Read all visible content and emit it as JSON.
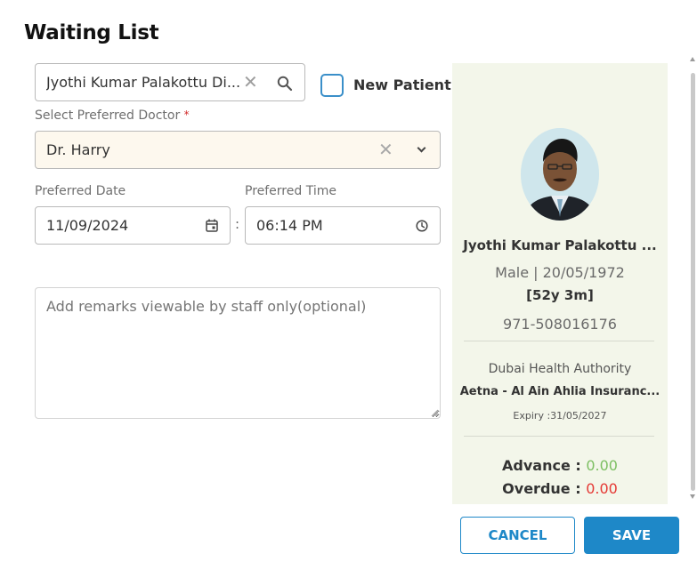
{
  "dialog": {
    "title": "Waiting List"
  },
  "form": {
    "patient_search_value": "Jyothi Kumar Palakottu   Di...",
    "new_patient_label": "New Patient",
    "doctor_label": "Select Preferred Doctor",
    "doctor_required_mark": "*",
    "doctor_value": "Dr. Harry",
    "date_label": "Preferred Date",
    "date_value": "11/09/2024",
    "time_separator": ":",
    "time_label": "Preferred Time",
    "time_value": "06:14 PM",
    "remarks_placeholder": "Add remarks viewable by staff only(optional)"
  },
  "patient_card": {
    "name": "Jyothi Kumar Palakottu ...",
    "gender_dob": "Male | 20/05/1972",
    "age": "[52y 3m]",
    "phone": "971-508016176",
    "authority": "Dubai Health Authority",
    "insurance": "Aetna - Al Ain Ahlia Insuranc...",
    "expiry": "Expiry :31/05/2027",
    "advance_label": "Advance :",
    "advance_value": "0.00",
    "overdue_label": "Overdue :",
    "overdue_value": "0.00"
  },
  "actions": {
    "cancel_label": "CANCEL",
    "save_label": "SAVE"
  },
  "icons": {
    "search": "search-icon",
    "clear": "close-icon",
    "dropdown": "chevron-down-icon",
    "calendar": "calendar-icon",
    "clock": "clock-icon"
  },
  "colors": {
    "accent": "#1e88c8",
    "panel_bg": "#f3f6ea",
    "advance": "#7cbf62",
    "overdue": "#e53935",
    "doctor_select_bg": "#fdf8ee"
  }
}
